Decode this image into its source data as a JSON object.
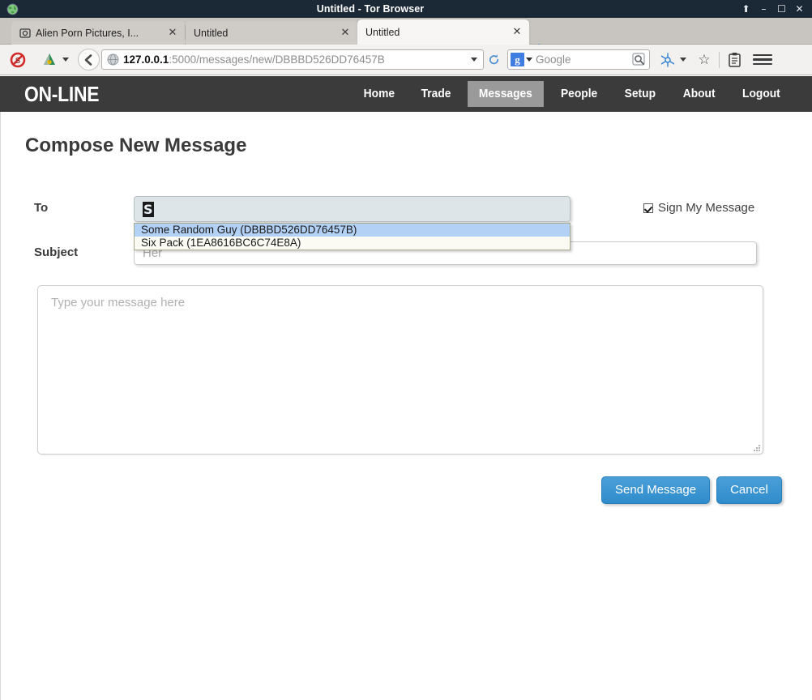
{
  "window": {
    "title": "Untitled - Tor Browser",
    "icon": "tor-globe-icon",
    "buttons": {
      "shade": "⬆",
      "minimize": "–",
      "maximize": "☐",
      "close": "✕"
    }
  },
  "tabs": [
    {
      "label": "Alien Porn Pictures, I...",
      "close": "✕",
      "active": false,
      "has_favicon": true
    },
    {
      "label": "Untitled",
      "close": "✕",
      "active": false,
      "has_favicon": false
    },
    {
      "label": "Untitled",
      "close": "✕",
      "active": true,
      "has_favicon": false
    }
  ],
  "newtab": {
    "label": "+"
  },
  "toolbar": {
    "noscript_icon": "noscript-icon",
    "torbutton_icon": "torbutton-onion-icon",
    "back_icon": "back-arrow-icon",
    "globe_icon": "globe-icon",
    "url_host": "127.0.0.1",
    "url_path": ":5000/messages/new/DBBBD526DD76457B",
    "url_full": "127.0.0.1:5000/messages/new/DBBBD526DD76457B",
    "reload_icon": "reload-icon",
    "search_engine": "Google",
    "search_engine_glyph": "g",
    "search_placeholder": "Google",
    "search_magnifier_icon": "search-magnifier-icon",
    "https_everywhere_icon": "https-everywhere-icon",
    "bookmark_star": "☆",
    "clipboard_icon": "clipboard-icon",
    "menu_icon": "hamburger-menu-icon"
  },
  "site": {
    "brand": "ON-LINE",
    "nav": [
      {
        "label": "Home",
        "active": false
      },
      {
        "label": "Trade",
        "active": false
      },
      {
        "label": "Messages",
        "active": true
      },
      {
        "label": "People",
        "active": false
      },
      {
        "label": "Setup",
        "active": false
      },
      {
        "label": "About",
        "active": false
      },
      {
        "label": "Logout",
        "active": false
      }
    ]
  },
  "form": {
    "page_title": "Compose New Message",
    "to_label": "To",
    "to_value": "S",
    "subject_label": "Subject",
    "subject_placeholder": "Her",
    "sign_label": "Sign My Message",
    "sign_checked": true,
    "message_placeholder": "Type your message here",
    "send_label": "Send Message",
    "cancel_label": "Cancel"
  },
  "autocomplete": {
    "options": [
      {
        "label": "Some Random Guy (DBBBD526DD76457B)",
        "selected": true
      },
      {
        "label": "Six Pack (1EA8616BC6C74E8A)",
        "selected": false
      }
    ]
  },
  "colors": {
    "titlebar": "#1b2836",
    "site_header": "#3b3b3b",
    "nav_active": "#9a9a9a",
    "button_blue": "#3590cd",
    "autocomplete_selected": "#b3d1f5"
  }
}
